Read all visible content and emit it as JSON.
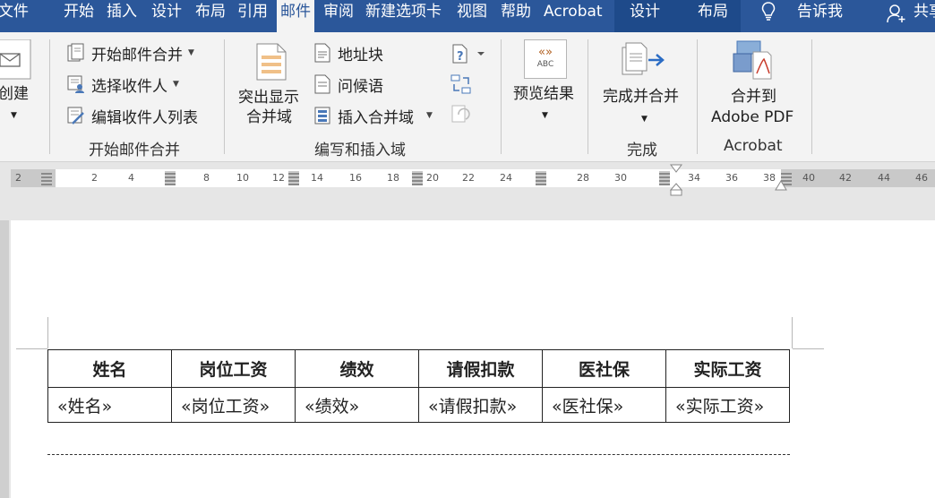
{
  "menu": {
    "tabs": [
      "文件",
      "开始",
      "插入",
      "设计",
      "布局",
      "引用",
      "邮件",
      "审阅",
      "新建选项卡",
      "视图",
      "帮助",
      "Acrobat"
    ],
    "active": "邮件",
    "context_tabs": [
      "设计",
      "布局"
    ],
    "tell_me": "告诉我",
    "share": "共享"
  },
  "ribbon": {
    "create": {
      "label": "创建"
    },
    "start_merge": {
      "commands": [
        "开始邮件合并",
        "选择收件人",
        "编辑收件人列表"
      ],
      "group_label": "开始邮件合并"
    },
    "write_insert": {
      "highlight": [
        "突出显示",
        "合并域"
      ],
      "commands": [
        "地址块",
        "问候语",
        "插入合并域"
      ],
      "group_label": "编写和插入域"
    },
    "preview": {
      "label": "预览结果",
      "icon_text": "ABC"
    },
    "finish": {
      "label": "完成并合并",
      "group_label": "完成"
    },
    "acrobat": {
      "label": [
        "合并到",
        "Adobe PDF"
      ],
      "group_label": "Acrobat"
    }
  },
  "ruler": {
    "numbers": [
      "2",
      "2",
      "4",
      "8",
      "10",
      "12",
      "14",
      "16",
      "18",
      "20",
      "22",
      "24",
      "28",
      "30",
      "34",
      "36",
      "38",
      "40",
      "42",
      "44",
      "46"
    ]
  },
  "table": {
    "headers": [
      "姓名",
      "岗位工资",
      "绩效",
      "请假扣款",
      "医社保",
      "实际工资"
    ],
    "fields": [
      "«姓名»",
      "«岗位工资»",
      "«绩效»",
      "«请假扣款»",
      "«医社保»",
      "«实际工资»"
    ]
  },
  "colors": {
    "accent": "#2b579a",
    "ribbon": "#f3f3f3",
    "page": "#ffffff"
  }
}
